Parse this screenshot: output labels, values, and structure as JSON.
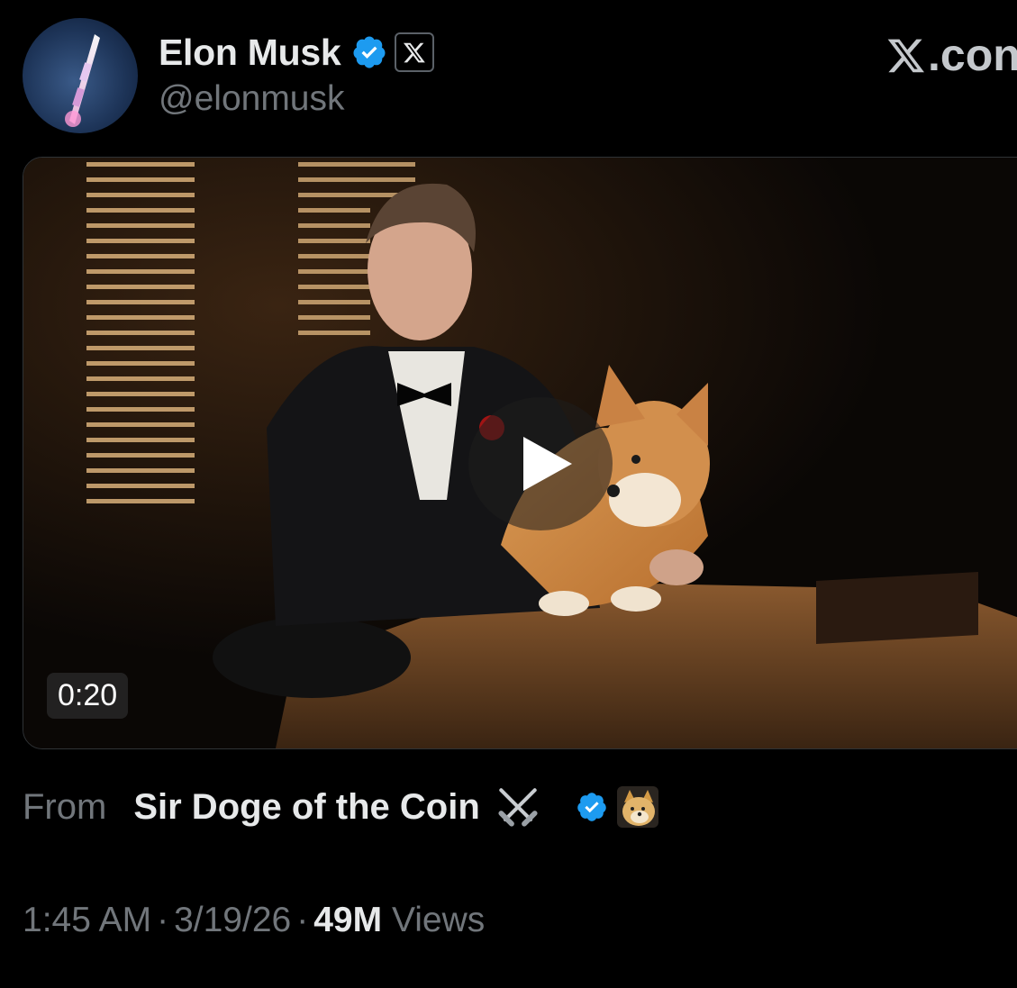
{
  "tweet": {
    "author": {
      "display_name": "Elon Musk",
      "handle": "@elonmusk",
      "verified": true,
      "affiliate_badge": "x-logo-icon"
    },
    "brand": {
      "text": ".con"
    },
    "media": {
      "type": "video",
      "duration": "0:20"
    },
    "from": {
      "label": "From",
      "source_name": "Sir Doge of the Coin",
      "source_emoji": "crossed-swords-icon",
      "source_verified": true
    },
    "meta": {
      "time": "1:45 AM",
      "date": "3/19/26",
      "separator": "·",
      "views_count": "49M",
      "views_label": "Views"
    }
  },
  "colors": {
    "background": "#000000",
    "primary_text": "#e7e9ea",
    "secondary_text": "#71767b",
    "verified_blue": "#1d9bf0"
  }
}
